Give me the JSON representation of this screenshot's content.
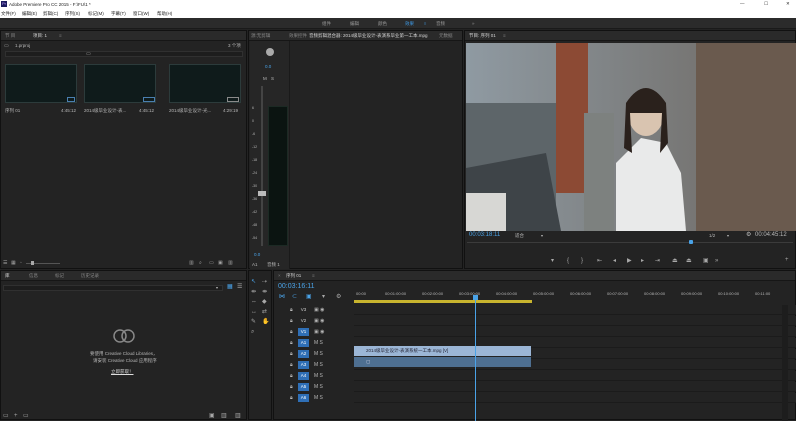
{
  "app": {
    "title": "Adobe Premiere Pro CC 2015 - F:\\FU\\1 *"
  },
  "window_controls": {
    "minimize": "—",
    "maximize": "☐",
    "close": "✕"
  },
  "menu": [
    "文件(F)",
    "编辑(E)",
    "剪辑(C)",
    "序列(S)",
    "标记(M)",
    "字幕(T)",
    "窗口(W)",
    "帮助(H)"
  ],
  "workspaces": [
    "组件",
    "编辑",
    "颜色",
    "效果",
    "音频"
  ],
  "workspace_more": "»",
  "project_panel": {
    "tabs": [
      "节 目",
      "项目: 1",
      "≡"
    ],
    "project_file": "1.prproj",
    "item_count": "3 个项",
    "items": [
      {
        "name": "序列 01",
        "duration": "4:45:12"
      },
      {
        "name": "2014级毕业设计-表...",
        "duration": "4:45:12"
      },
      {
        "name": "2014级毕业设计-光...",
        "duration": "4:29:19"
      }
    ]
  },
  "audio_mixer": {
    "tab": "音频剪辑混合器: 序列 01",
    "scale": [
      "6",
      "0",
      "-6",
      "-12",
      "-18",
      "-24",
      "-30",
      "-36",
      "-42",
      "-48",
      "-54"
    ],
    "db_label": "0.0",
    "track": "A1",
    "track_name": "音频 1",
    "solo": "S",
    "mute": "M"
  },
  "source_tabs": [
    "源:无剪辑",
    "效果控件",
    "音频剪辑混合器: 2014级毕业设计-表演系毕业第一工本.mpg",
    "元数据"
  ],
  "program_monitor": {
    "tab": "节目: 序列 01",
    "menu_icon": "≡",
    "current_tc": "00:03:18:11",
    "fit": "适合",
    "quality": "1/2",
    "duration_tc": "00:04:45:12"
  },
  "lib_panel": {
    "tabs": [
      "库",
      "信息",
      "标记",
      "历史记录"
    ],
    "message_line1": "要使用 Creative Cloud Libraries，",
    "message_line2": "请安装 Creative Cloud 应用程序",
    "link": "立即获取！"
  },
  "timeline": {
    "tab": "序列 01",
    "current_tc": "00:03:16:11",
    "ruler": [
      "00:00",
      "00:01:00:00",
      "00:02:00:00",
      "00:03:00:00",
      "00:04:00:00",
      "00:05:00:00",
      "00:06:00:00",
      "00:07:00:00",
      "00:08:00:00",
      "00:09:00:00",
      "00:10:00:00",
      "00:11:00"
    ],
    "tracks": [
      "V3",
      "V2",
      "V1",
      "A1",
      "A2",
      "A3",
      "A4",
      "A5",
      "A6"
    ],
    "video_clip": "2014级毕业设计-表演系统一工本.mpg [V]",
    "audio_clip_label": "▢"
  },
  "colors": {
    "accent": "#2f8fd8",
    "timecode": "#4aa3e8",
    "clip_video": "#9bb6d6",
    "clip_audio": "#4e6f91"
  }
}
